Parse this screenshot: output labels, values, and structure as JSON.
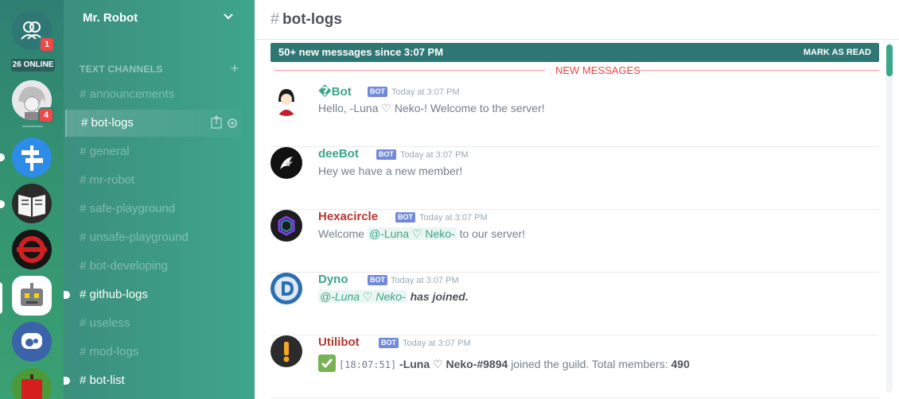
{
  "server_rail": {
    "home_badge": "1",
    "online_count": "26 ONLINE",
    "robot_badge": "4"
  },
  "guild": {
    "name": "Mr. Robot"
  },
  "sidebar": {
    "category": "TEXT CHANNELS",
    "add": "+",
    "channels": [
      "# announcements",
      "# bot-logs",
      "# general",
      "# mr-robot",
      "# safe-playground",
      "# unsafe-playground",
      "# bot-developing",
      "# github-logs",
      "# useless",
      "# mod-logs",
      "# bot-list"
    ]
  },
  "channel": {
    "hash": "#",
    "name": "bot-logs"
  },
  "new_bar": {
    "text": "50+ new messages since 3:07 PM",
    "action": "MARK AS READ"
  },
  "divider": {
    "label": "NEW MESSAGES"
  },
  "messages": [
    {
      "author": "�Bot",
      "author_color": "#3aa68b",
      "tag": "BOT",
      "time": "Today at 3:07 PM",
      "text": "Hello, -Luna ♡ Neko-! Welcome to the server!"
    },
    {
      "author": "deeBot",
      "author_color": "#3aa68b",
      "tag": "BOT",
      "time": "Today at 3:07 PM",
      "text": "Hey we have a new member!"
    },
    {
      "author": "Hexacircle",
      "author_color": "#b5372f",
      "tag": "BOT",
      "time": "Today at 3:07 PM",
      "pre": "Welcome",
      "mention": "@-Luna ♡ Neko-",
      "post": "to our server!"
    },
    {
      "author": "Dyno",
      "author_color": "#3aa68b",
      "tag": "BOT",
      "time": "Today at 3:07 PM",
      "mention": "@-Luna ♡ Neko-",
      "post": "has joined."
    },
    {
      "author": "Utilibot",
      "author_color": "#b5372f",
      "tag": "BOT",
      "time": "Today at 3:07 PM",
      "code": "[18:07:51]",
      "user": "-Luna ♡ Neko-#9894",
      "mid": "joined the guild. Total members:",
      "count": "490"
    }
  ],
  "colors": {
    "accent": "#3aa68b",
    "badge": "#f04747",
    "bot_tag": "#7289da",
    "bar": "#2f7774"
  }
}
